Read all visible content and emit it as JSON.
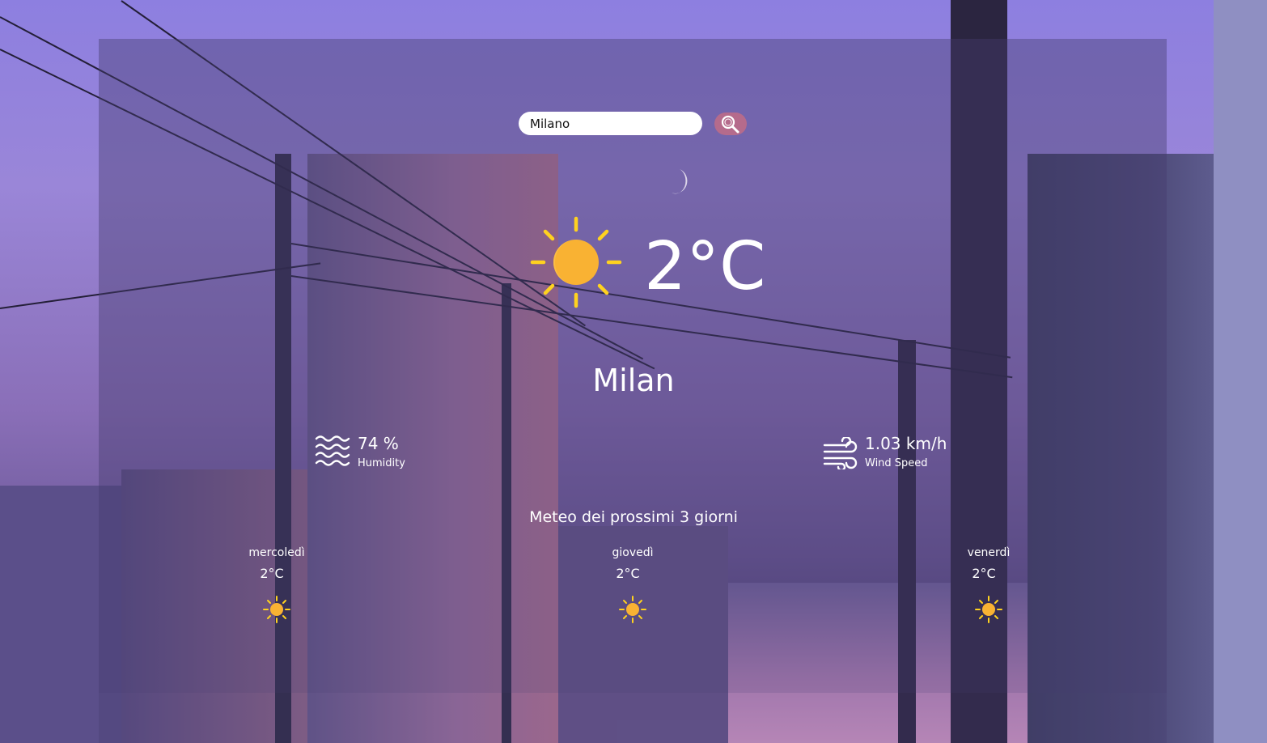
{
  "search": {
    "value": "Milano",
    "button_icon": "magnifier-icon"
  },
  "current": {
    "icon": "sun-icon",
    "temperature": "2°C",
    "city": "Milan"
  },
  "humidity": {
    "icon": "waves-icon",
    "value": "74 %",
    "label": "Humidity"
  },
  "wind": {
    "icon": "wind-icon",
    "value": "1.03 km/h",
    "label": "Wind Speed"
  },
  "forecast": {
    "title": "Meteo dei prossimi 3 giorni",
    "days": [
      {
        "name": "mercoledì",
        "temp": "2°C",
        "icon": "sun-icon"
      },
      {
        "name": "giovedì",
        "temp": "2°C",
        "icon": "sun-icon"
      },
      {
        "name": "venerdì",
        "temp": "2°C",
        "icon": "sun-icon"
      }
    ]
  },
  "colors": {
    "sun": "#f9b233",
    "sun_rays": "#ffd21f",
    "search_button": "#b56b8c",
    "panel_overlay": "#463c6e"
  }
}
